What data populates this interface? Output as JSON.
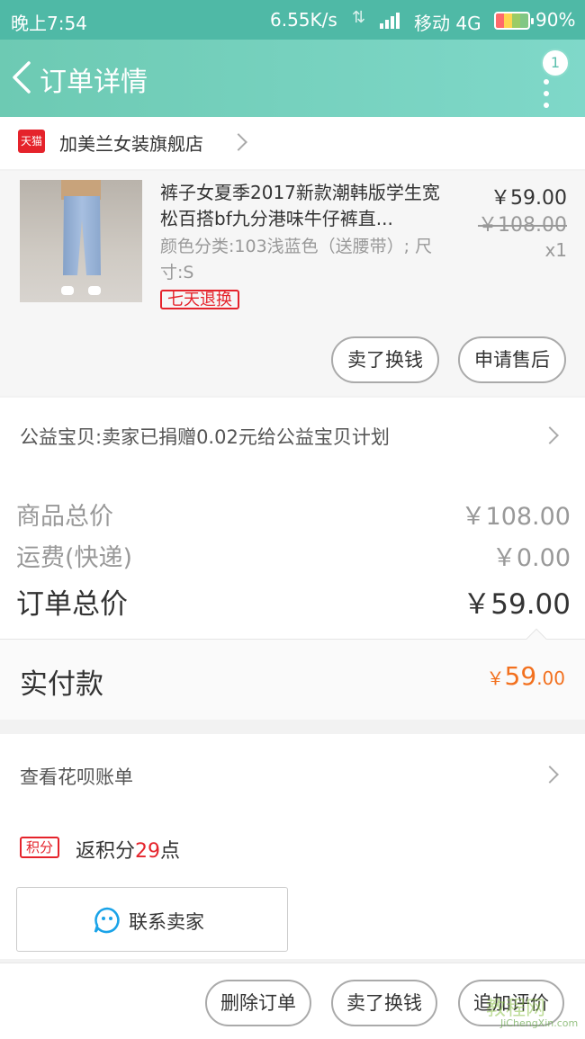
{
  "status_bar": {
    "time": "晚上7:54",
    "speed": "6.55K/s",
    "net_arrows": "⇅",
    "carrier": "移动 4G",
    "battery": "90%"
  },
  "header": {
    "title": "订单详情",
    "badge_count": "1"
  },
  "shop": {
    "badge": "天猫",
    "name": "加美兰女装旗舰店"
  },
  "product": {
    "title": "裤子女夏季2017新款潮韩版学生宽松百搭bf九分港味牛仔裤直...",
    "attrs": "颜色分类:103浅蓝色（送腰带）; 尺寸:S",
    "tag": "七天退换",
    "price": "￥59.00",
    "original_price": "￥108.00",
    "qty": "x1",
    "buttons": [
      "卖了换钱",
      "申请售后"
    ]
  },
  "charity": {
    "text": "公益宝贝:卖家已捐赠0.02元给公益宝贝计划"
  },
  "totals": {
    "goods_label": "商品总价",
    "goods_value": "￥108.00",
    "shipping_label": "运费(快递)",
    "shipping_value": "￥0.00",
    "order_label": "订单总价",
    "order_value": "￥59.00"
  },
  "paid": {
    "label": "实付款",
    "currency": "￥",
    "integer": "59",
    "decimal": ".00"
  },
  "huabei": {
    "text": "查看花呗账单"
  },
  "points": {
    "tag": "积分",
    "prefix": "返积分",
    "amount": "29",
    "suffix": "点"
  },
  "contact": {
    "label": "联系卖家"
  },
  "bottom": {
    "buttons": [
      "删除订单",
      "卖了换钱",
      "追加评价"
    ]
  },
  "watermark": {
    "logo": "教程网",
    "url": "JiChengXin.com"
  },
  "colors": {
    "header": "#6dcab3",
    "accent_red": "#e5232b",
    "paid_orange": "#f2701e"
  }
}
